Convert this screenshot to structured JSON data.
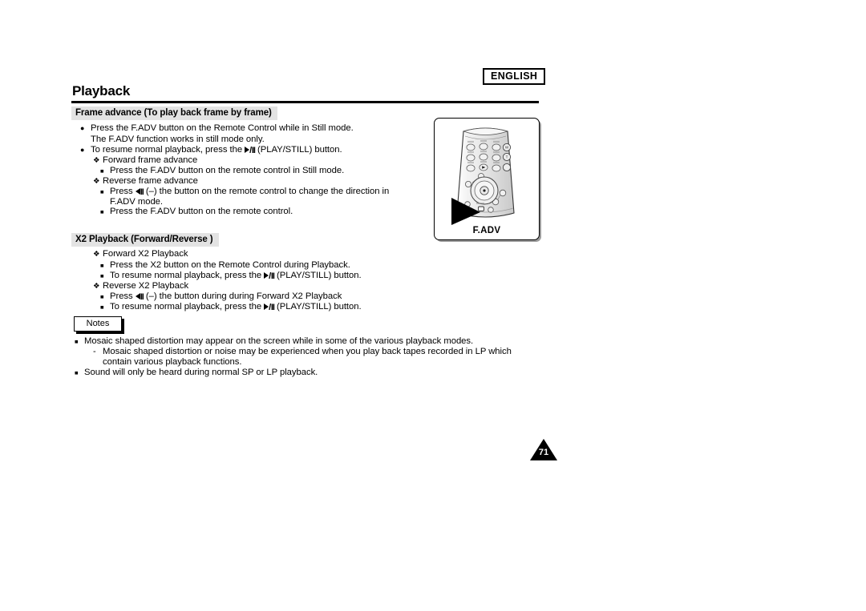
{
  "header": {
    "language_badge": "ENGLISH",
    "title": "Playback"
  },
  "sections": [
    {
      "id": "frame_advance",
      "heading": "Frame advance (To play back frame by frame)",
      "lines": [
        {
          "marker": "dot",
          "text_before": "Press the F.ADV button on the Remote Control while in Still mode."
        },
        {
          "marker": "none",
          "text_before": "The F.ADV function works in still mode only."
        },
        {
          "marker": "dot",
          "text_before": "To resume normal playback, press the ",
          "glyph": "play-still",
          "text_after": "(PLAY/STILL) button."
        },
        {
          "marker": "flower",
          "text_before": "Forward frame advance"
        },
        {
          "marker": "square",
          "text_before": "Press the F.ADV button on the remote control in Still mode."
        },
        {
          "marker": "flower",
          "text_before": "Reverse frame advance"
        },
        {
          "marker": "square",
          "text_before": "Press ",
          "glyph": "reverse",
          "text_after": "(–) the button on the remote control to change the direction in"
        },
        {
          "marker": "none",
          "text_before": "F.ADV mode."
        },
        {
          "marker": "square",
          "text_before": "Press the F.ADV button on the remote control."
        }
      ]
    },
    {
      "id": "x2_playback",
      "heading": "X2 Playback (Forward/Reverse )",
      "lines": [
        {
          "marker": "flower",
          "text_before": "Forward X2 Playback"
        },
        {
          "marker": "square",
          "text_before": "Press the X2 button on the Remote Control during Playback."
        },
        {
          "marker": "square",
          "text_before": "To resume normal playback, press the ",
          "glyph": "play-still",
          "text_after": "(PLAY/STILL) button."
        },
        {
          "marker": "flower",
          "text_before": "Reverse X2 Playback"
        },
        {
          "marker": "square",
          "text_before": "Press ",
          "glyph": "reverse",
          "text_after": "(–) the button during during Forward X2 Playback"
        },
        {
          "marker": "square",
          "text_before": "To resume normal playback, press the ",
          "glyph": "play-still",
          "text_after": "(PLAY/STILL) button."
        }
      ]
    }
  ],
  "notes": {
    "label": "Notes",
    "lines": [
      {
        "marker": "square",
        "text_before": "Mosaic shaped distortion may appear on the screen while in some of the various playback modes."
      },
      {
        "marker": "dash",
        "text_before": "Mosaic shaped distortion or noise may be experienced when you play back tapes recorded in LP which"
      },
      {
        "marker": "none",
        "text_before": "contain various playback functions."
      },
      {
        "marker": "square",
        "text_before": "Sound will only be heard during normal SP or LP playback."
      }
    ]
  },
  "illustration": {
    "caption": "F.ADV",
    "alt": "remote-control-diagram"
  },
  "footer": {
    "page_number": "71"
  }
}
